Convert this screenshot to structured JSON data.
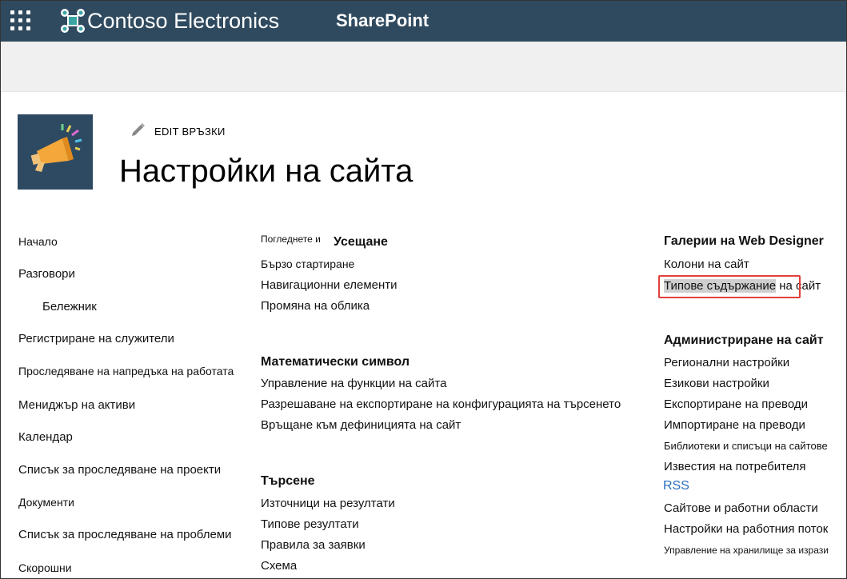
{
  "suite_bar": {
    "brand": "Contoso Electronics",
    "product": "SharePoint",
    "waffle_icon": "app-launcher-icon",
    "logo_icon": "contoso-logo-icon",
    "background": "#2f4a5f"
  },
  "header": {
    "edit_links": "EDIT ВРЪЗКИ",
    "page_title": "Настройки на сайта",
    "site_logo_icon": "megaphone-icon"
  },
  "left_nav": {
    "items": [
      "Начало",
      "Разговори",
      "Бележник",
      "Регистриране на служители",
      "Проследяване на напредъка на работата",
      "Мениджър на активи",
      "Календар",
      "Списък за проследяване на проекти",
      "Документи",
      "Списък за проследяване на проблеми",
      "Скорошни"
    ]
  },
  "look_and_feel": {
    "prefix": "Погледнете и",
    "title": "Усещане",
    "links": [
      "Бързо стартиране",
      "Навигационни елементи",
      "Промяна на облика"
    ]
  },
  "site_actions": {
    "title": "Математически символ",
    "links": [
      "Управление на функции на сайта",
      "Разрешаване на експортиране на конфигурацията на търсенето",
      "Връщане към дефиницията на сайт"
    ]
  },
  "search": {
    "title": "Търсене",
    "links": [
      "Източници на резултати",
      "Типове резултати",
      "Правила за заявки",
      "Схема"
    ]
  },
  "web_designer": {
    "title": "Галерии на Web Designer",
    "links": [
      "Колони на сайт"
    ],
    "content_types_highlighted": "Типове съдържание",
    "content_types_rest": " на сайт"
  },
  "site_admin": {
    "title": "Администриране на сайт",
    "links": [
      "Регионални настройки",
      "Езикови настройки",
      "Експортиране на преводи",
      "Импортиране на преводи",
      "Библиотеки и списъци на сайтове",
      "Известия на потребителя",
      "RSS",
      "Сайтове и работни области",
      "Настройки на работния поток",
      "Управление на хранилище за изрази"
    ]
  },
  "colors": {
    "highlight_box": "#e0403a",
    "rss_link": "#2b6fbf"
  }
}
